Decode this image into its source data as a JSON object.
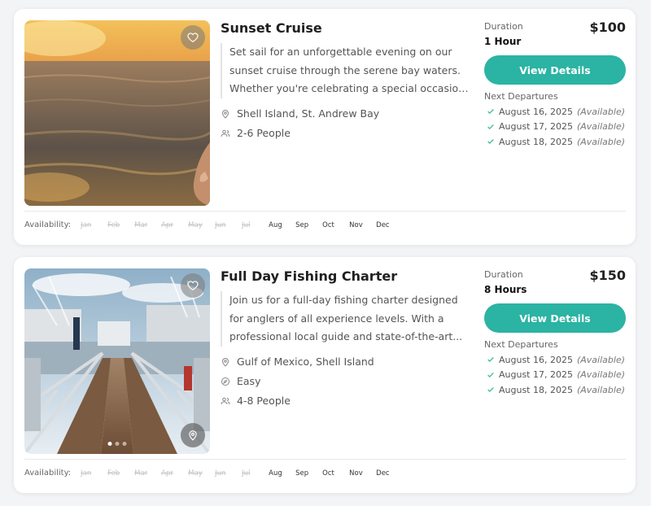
{
  "listings": [
    {
      "title": "Sunset Cruise",
      "description_lines": [
        "Set sail for an unforgettable evening on our",
        "sunset cruise through the serene bay waters.",
        "Whether you're celebrating a special occasion..."
      ],
      "location": "Shell Island, St. Andrew Bay",
      "people": "2-6 People",
      "duration_label": "Duration",
      "duration": "1 Hour",
      "price": "$100",
      "button_label": "View Details",
      "departures_label": "Next Departures",
      "departures": [
        {
          "date": "August 16, 2025",
          "status": "(Available)"
        },
        {
          "date": "August 17, 2025",
          "status": "(Available)"
        },
        {
          "date": "August 18, 2025",
          "status": "(Available)"
        }
      ],
      "availability_label": "Availability:",
      "months": [
        {
          "name": "Jan",
          "available": false
        },
        {
          "name": "Feb",
          "available": false
        },
        {
          "name": "Mar",
          "available": false
        },
        {
          "name": "Apr",
          "available": false
        },
        {
          "name": "May",
          "available": false
        },
        {
          "name": "Jun",
          "available": false
        },
        {
          "name": "Jul",
          "available": false
        },
        {
          "name": "Aug",
          "available": true
        },
        {
          "name": "Sep",
          "available": true
        },
        {
          "name": "Oct",
          "available": true
        },
        {
          "name": "Nov",
          "available": true
        },
        {
          "name": "Dec",
          "available": true
        }
      ]
    },
    {
      "title": "Full Day Fishing Charter",
      "description_lines": [
        "Join us for a full-day fishing charter designed",
        "for anglers of all experience levels. With a",
        "professional local guide and state-of-the-art..."
      ],
      "location": "Gulf of Mexico, Shell Island",
      "difficulty": "Easy",
      "people": "4-8 People",
      "duration_label": "Duration",
      "duration": "8 Hours",
      "price": "$150",
      "button_label": "View Details",
      "departures_label": "Next Departures",
      "departures": [
        {
          "date": "August 16, 2025",
          "status": "(Available)"
        },
        {
          "date": "August 17, 2025",
          "status": "(Available)"
        },
        {
          "date": "August 18, 2025",
          "status": "(Available)"
        }
      ],
      "availability_label": "Availability:",
      "months": [
        {
          "name": "Jan",
          "available": false
        },
        {
          "name": "Feb",
          "available": false
        },
        {
          "name": "Mar",
          "available": false
        },
        {
          "name": "Apr",
          "available": false
        },
        {
          "name": "May",
          "available": false
        },
        {
          "name": "Jun",
          "available": false
        },
        {
          "name": "Jul",
          "available": false
        },
        {
          "name": "Aug",
          "available": true
        },
        {
          "name": "Sep",
          "available": true
        },
        {
          "name": "Oct",
          "available": true
        },
        {
          "name": "Nov",
          "available": true
        },
        {
          "name": "Dec",
          "available": true
        }
      ]
    }
  ],
  "icons": {
    "favorite": "heart-icon",
    "location": "map-pin-icon",
    "people": "people-icon",
    "difficulty": "compass-icon",
    "check": "check-icon",
    "map": "map-pin-icon"
  },
  "colors": {
    "accent": "#2bb3a3",
    "check": "#3fbf8a",
    "unavailable_month": "#c4c4c4"
  }
}
